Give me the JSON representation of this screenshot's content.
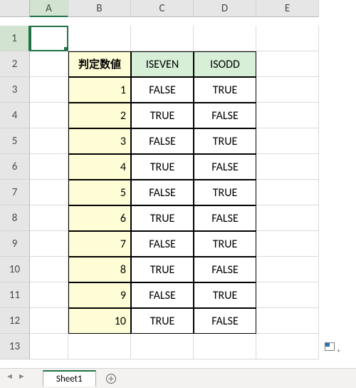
{
  "columns": [
    "A",
    "B",
    "C",
    "D",
    "E"
  ],
  "rows": [
    "1",
    "2",
    "3",
    "4",
    "5",
    "6",
    "7",
    "8",
    "9",
    "10",
    "11",
    "12",
    "13"
  ],
  "header": {
    "b": "判定数値",
    "c": "ISEVEN",
    "d": "ISODD"
  },
  "data": [
    {
      "n": "1",
      "iseven": "FALSE",
      "isodd": "TRUE"
    },
    {
      "n": "2",
      "iseven": "TRUE",
      "isodd": "FALSE"
    },
    {
      "n": "3",
      "iseven": "FALSE",
      "isodd": "TRUE"
    },
    {
      "n": "4",
      "iseven": "TRUE",
      "isodd": "FALSE"
    },
    {
      "n": "5",
      "iseven": "FALSE",
      "isodd": "TRUE"
    },
    {
      "n": "6",
      "iseven": "TRUE",
      "isodd": "FALSE"
    },
    {
      "n": "7",
      "iseven": "FALSE",
      "isodd": "TRUE"
    },
    {
      "n": "8",
      "iseven": "TRUE",
      "isodd": "FALSE"
    },
    {
      "n": "9",
      "iseven": "FALSE",
      "isodd": "TRUE"
    },
    {
      "n": "10",
      "iseven": "TRUE",
      "isodd": "FALSE"
    }
  ],
  "tabs": {
    "sheet1": "Sheet1"
  }
}
